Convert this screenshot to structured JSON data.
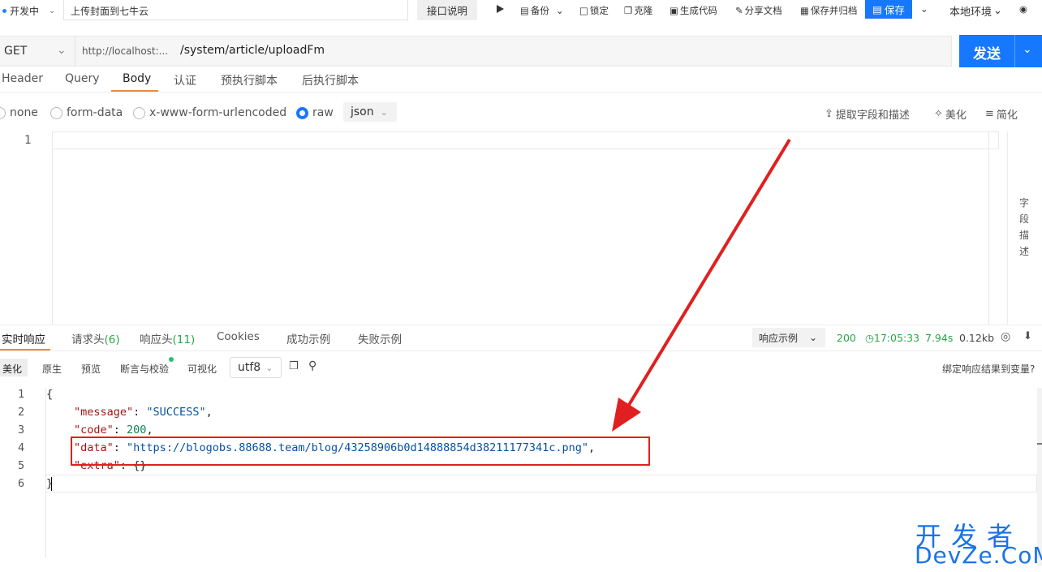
{
  "toolbar": {
    "status": "开发中",
    "api_name": "上传封面到七牛云",
    "doc_label": "接口说明",
    "backup": "备份",
    "lock": "锁定",
    "clone": "克隆",
    "gen_code": "生成代码",
    "share_doc": "分享文档",
    "save_archive": "保存并归档",
    "save": "保存",
    "env": "本地环境"
  },
  "request": {
    "method": "GET",
    "host": "http://localhost:...",
    "path": "/system/article/uploadFm",
    "send": "发送"
  },
  "request_tabs": [
    "Header",
    "Query",
    "Body",
    "认证",
    "预执行脚本",
    "后执行脚本"
  ],
  "body_types": {
    "none": "none",
    "form_data": "form-data",
    "urlencoded": "x-www-form-urlencoded",
    "raw": "raw",
    "format": "json"
  },
  "editor_tools": {
    "extract": "提取字段和描述",
    "beautify": "美化",
    "simplify": "简化"
  },
  "editor": {
    "line_no": "1",
    "side_label": "字段描述"
  },
  "response_tabs": {
    "realtime": "实时响应",
    "req_headers": "请求头",
    "req_headers_count": "(6)",
    "resp_headers": "响应头",
    "resp_headers_count": "(11)",
    "cookies": "Cookies",
    "success_example": "成功示例",
    "fail_example": "失败示例"
  },
  "response_meta": {
    "example_select": "响应示例",
    "status": "200",
    "time": "17:05:33",
    "duration": "7.94s",
    "size": "0.12kb"
  },
  "response_sub": {
    "beautify": "美化",
    "raw": "原生",
    "preview": "预览",
    "assert": "断言与校验",
    "visualize": "可视化",
    "encoding": "utf8",
    "bind_var": "绑定响应结果到变量?"
  },
  "response_json": {
    "open": "{",
    "message_key": "\"message\"",
    "message_val": "\"SUCCESS\"",
    "code_key": "\"code\"",
    "code_val": "200",
    "data_key": "\"data\"",
    "data_val": "\"https://blogobs.88688.team/blog/43258906b0d14888854d38211177341c.png\"",
    "extra_key": "\"extra\"",
    "extra_val": "{}",
    "close": "}"
  },
  "watermark": {
    "line1": "开发者",
    "line2": "DevZe.CoM"
  },
  "colors": {
    "accent": "#1677ff",
    "annotation": "#e02020",
    "success": "#28a745"
  }
}
